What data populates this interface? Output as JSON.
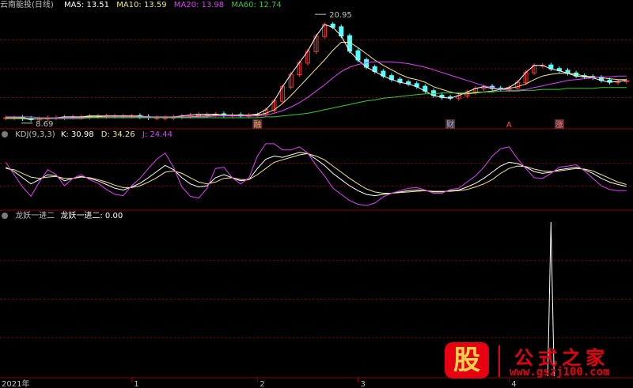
{
  "panel_main": {
    "title": "云南能投(日线)",
    "ma": [
      {
        "label": "MA5: 13.51",
        "color": "#ffffff"
      },
      {
        "label": "MA10: 13.59",
        "color": "#f0e68c"
      },
      {
        "label": "MA20: 13.98",
        "color": "#e040fb"
      },
      {
        "label": "MA60: 12.74",
        "color": "#33cc33"
      }
    ]
  },
  "panel_kdj": {
    "title": "KDJ(9,3,3)",
    "k": {
      "label": "K: 30.98",
      "color": "#ffffff"
    },
    "d": {
      "label": "D: 34.26",
      "color": "#f0e68c"
    },
    "j": {
      "label": "J: 24.44",
      "color": "#e040fb"
    }
  },
  "panel_ind": {
    "title": "龙妖一进二",
    "value": "龙妖一进二: 0.00"
  },
  "colors": {
    "up": "#ff3232",
    "down": "#54ffff",
    "grid": "#8b0000",
    "text": "#c0c0c0"
  },
  "icons": [
    "eye-circle-icon"
  ],
  "watermark": {
    "seal": "股",
    "title": "公式之家",
    "url": "www.gszj100.com"
  },
  "chart_data": [
    {
      "type": "candlestick",
      "series": [
        {
          "name": "MA5",
          "values": [
            9.3,
            9.3,
            9.2,
            9.1,
            9.2,
            9.3,
            9.3,
            9.4,
            9.4,
            9.4,
            9.5,
            9.5,
            9.5,
            9.5,
            9.5,
            9.5,
            9.4,
            9.3,
            9.3,
            9.3,
            9.4,
            9.5,
            9.6,
            9.7,
            9.7,
            9.7,
            9.6,
            9.6,
            9.5,
            9.6,
            9.7,
            10.2,
            11.2,
            12.8,
            14.2,
            15.5,
            16.8,
            18.5,
            19.8,
            19.5,
            18.5,
            16.8,
            15.8,
            15.0,
            14.5,
            14.0,
            13.6,
            13.3,
            13.1,
            12.8,
            12.3,
            11.8,
            11.6,
            11.5,
            11.8,
            12.2,
            12.6,
            12.8,
            12.6,
            12.5,
            12.7,
            13.3,
            14.4,
            15.2,
            15.2,
            14.8,
            14.6,
            14.3,
            14.0,
            13.9,
            13.8,
            13.5,
            13.3,
            13.4,
            13.5
          ]
        },
        {
          "name": "MA10",
          "values": [
            9.3,
            9.3,
            9.3,
            9.2,
            9.2,
            9.2,
            9.3,
            9.3,
            9.3,
            9.4,
            9.4,
            9.4,
            9.5,
            9.5,
            9.5,
            9.5,
            9.5,
            9.4,
            9.4,
            9.4,
            9.4,
            9.4,
            9.4,
            9.5,
            9.5,
            9.6,
            9.6,
            9.6,
            9.6,
            9.6,
            9.6,
            9.8,
            10.2,
            10.9,
            11.8,
            12.8,
            13.8,
            14.8,
            15.8,
            16.9,
            17.8,
            17.8,
            17.2,
            16.5,
            15.8,
            15.2,
            14.7,
            14.2,
            13.8,
            13.6,
            13.3,
            12.8,
            12.5,
            12.2,
            12.0,
            12.0,
            12.1,
            12.2,
            12.3,
            12.5,
            12.6,
            12.8,
            13.1,
            13.6,
            14.0,
            14.2,
            14.3,
            14.3,
            14.2,
            14.0,
            13.9,
            13.8,
            13.7,
            13.6,
            13.6
          ]
        },
        {
          "name": "MA20",
          "values": [
            9.4,
            9.4,
            9.4,
            9.4,
            9.3,
            9.3,
            9.3,
            9.3,
            9.3,
            9.3,
            9.3,
            9.3,
            9.4,
            9.4,
            9.4,
            9.4,
            9.4,
            9.4,
            9.4,
            9.4,
            9.4,
            9.4,
            9.4,
            9.4,
            9.4,
            9.5,
            9.5,
            9.5,
            9.5,
            9.5,
            9.5,
            9.6,
            9.8,
            10.1,
            10.5,
            11.0,
            11.6,
            12.3,
            13.0,
            13.8,
            14.5,
            15.0,
            15.3,
            15.5,
            15.6,
            15.6,
            15.6,
            15.5,
            15.4,
            15.2,
            15.0,
            14.7,
            14.4,
            14.1,
            13.8,
            13.5,
            13.2,
            12.9,
            12.7,
            12.5,
            12.4,
            12.4,
            12.5,
            12.7,
            12.9,
            13.1,
            13.3,
            13.5,
            13.6,
            13.7,
            13.8,
            13.9,
            13.9,
            14.0,
            14.0
          ]
        },
        {
          "name": "MA60",
          "values": [
            9.2,
            9.2,
            9.2,
            9.2,
            9.2,
            9.2,
            9.2,
            9.2,
            9.2,
            9.2,
            9.3,
            9.3,
            9.3,
            9.3,
            9.3,
            9.3,
            9.3,
            9.3,
            9.3,
            9.3,
            9.3,
            9.3,
            9.3,
            9.3,
            9.3,
            9.3,
            9.3,
            9.3,
            9.3,
            9.3,
            9.3,
            9.4,
            9.4,
            9.5,
            9.6,
            9.7,
            9.8,
            10.0,
            10.2,
            10.4,
            10.6,
            10.8,
            11.0,
            11.2,
            11.3,
            11.5,
            11.6,
            11.7,
            11.8,
            11.9,
            12.0,
            12.0,
            12.1,
            12.1,
            12.1,
            12.1,
            12.2,
            12.2,
            12.2,
            12.3,
            12.3,
            12.3,
            12.4,
            12.4,
            12.5,
            12.5,
            12.5,
            12.6,
            12.6,
            12.6,
            12.6,
            12.7,
            12.7,
            12.7,
            12.7
          ]
        }
      ],
      "annotations": [
        {
          "label": "20.95",
          "value": 20.95,
          "index": 38
        },
        {
          "label": "8.69",
          "value": 8.69,
          "index": 3
        }
      ],
      "event_labels": [
        "融",
        "财",
        "A",
        "涨"
      ]
    },
    {
      "type": "line",
      "title": "KDJ(9,3,3)",
      "ylim": [
        -5,
        105
      ],
      "series": [
        {
          "name": "K",
          "values": [
            62,
            55,
            45,
            35,
            42,
            50,
            48,
            40,
            44,
            47,
            44,
            40,
            34,
            28,
            25,
            30,
            36,
            45,
            55,
            65,
            58,
            45,
            35,
            30,
            32,
            45,
            50,
            45,
            40,
            42,
            60,
            75,
            80,
            78,
            82,
            86,
            84,
            75,
            65,
            52,
            42,
            32,
            24,
            18,
            16,
            18,
            20,
            22,
            24,
            25,
            24,
            22,
            22,
            24,
            25,
            30,
            36,
            44,
            54,
            64,
            70,
            68,
            62,
            55,
            52,
            54,
            58,
            60,
            62,
            58,
            52,
            44,
            38,
            34,
            31
          ]
        },
        {
          "name": "D",
          "values": [
            60,
            58,
            52,
            46,
            44,
            46,
            47,
            44,
            44,
            46,
            45,
            42,
            38,
            33,
            29,
            29,
            32,
            38,
            45,
            54,
            56,
            52,
            45,
            38,
            35,
            38,
            44,
            45,
            42,
            42,
            50,
            60,
            70,
            74,
            78,
            82,
            84,
            80,
            74,
            64,
            54,
            44,
            35,
            27,
            22,
            20,
            20,
            21,
            22,
            23,
            24,
            23,
            23,
            23,
            24,
            26,
            30,
            35,
            42,
            52,
            60,
            64,
            63,
            59,
            56,
            55,
            56,
            58,
            60,
            59,
            56,
            50,
            44,
            38,
            34
          ]
        },
        {
          "name": "J",
          "values": [
            70,
            50,
            30,
            15,
            38,
            58,
            50,
            32,
            44,
            50,
            42,
            36,
            26,
            18,
            16,
            32,
            44,
            60,
            75,
            85,
            62,
            30,
            15,
            12,
            28,
            60,
            62,
            45,
            35,
            45,
            80,
            100,
            100,
            90,
            90,
            95,
            85,
            65,
            48,
            28,
            18,
            8,
            2,
            0,
            4,
            14,
            20,
            24,
            28,
            29,
            25,
            20,
            20,
            26,
            28,
            38,
            48,
            62,
            80,
            92,
            95,
            76,
            60,
            45,
            44,
            52,
            62,
            64,
            66,
            56,
            44,
            32,
            26,
            24,
            24
          ]
        }
      ]
    },
    {
      "type": "bar",
      "title": "龙妖一进二",
      "ylim": [
        0,
        1
      ],
      "values": [
        0,
        0,
        0,
        0,
        0,
        0,
        0,
        0,
        0,
        0,
        0,
        0,
        0,
        0,
        0,
        0,
        0,
        0,
        0,
        0,
        0,
        0,
        0,
        0,
        0,
        0,
        0,
        0,
        0,
        0,
        0,
        0,
        0,
        0,
        0,
        0,
        0,
        0,
        0,
        0,
        0,
        0,
        0,
        0,
        0,
        0,
        0,
        0,
        0,
        0,
        0,
        0,
        0,
        0,
        0,
        0,
        0,
        0,
        0,
        0,
        0,
        0,
        0,
        0,
        0,
        1,
        0,
        0,
        0,
        0,
        0,
        0,
        0,
        0,
        0
      ]
    }
  ],
  "xaxis": {
    "ticks": [
      "2021年",
      "1",
      "2",
      "3",
      "4"
    ]
  }
}
